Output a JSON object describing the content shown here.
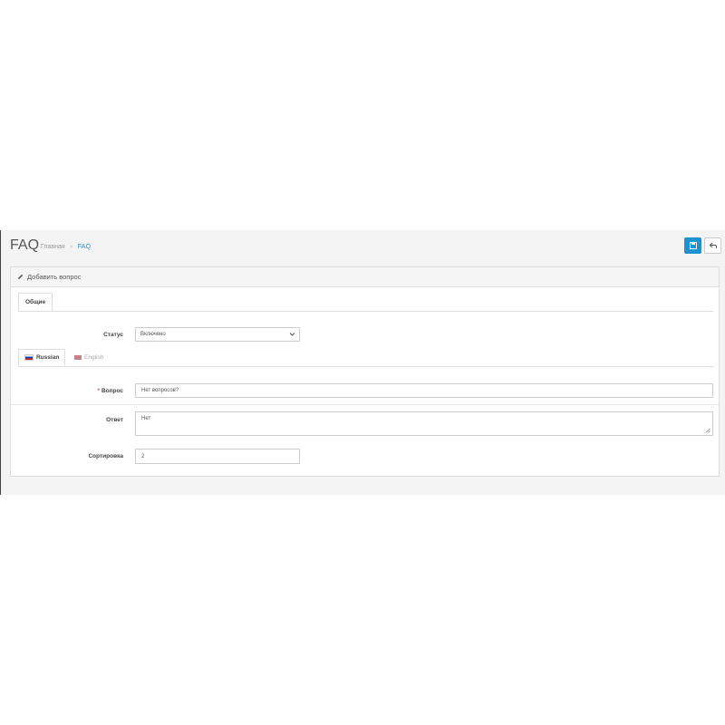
{
  "header": {
    "title": "FAQ",
    "breadcrumb": [
      {
        "label": "Главная"
      },
      {
        "label": "FAQ"
      }
    ],
    "breadcrumb_sep": "›",
    "save_icon": "save-icon",
    "back_icon": "reply-icon"
  },
  "panel": {
    "heading": "Добавить вопрос",
    "heading_icon": "pencil-icon"
  },
  "tabs": {
    "general": "Общие"
  },
  "form": {
    "status_label": "Статус",
    "status_value": "Включено",
    "question_label": "Вопрос",
    "question_required": "*",
    "question_value": "Нет вопросов?",
    "answer_label": "Ответ",
    "answer_value": "Нет",
    "sort_label": "Сортировка",
    "sort_value": "2"
  },
  "languages": [
    {
      "label": "Russian",
      "active": true
    },
    {
      "label": "English",
      "active": false
    }
  ],
  "colors": {
    "primary": "#1e91cf",
    "required": "#e3503e"
  }
}
